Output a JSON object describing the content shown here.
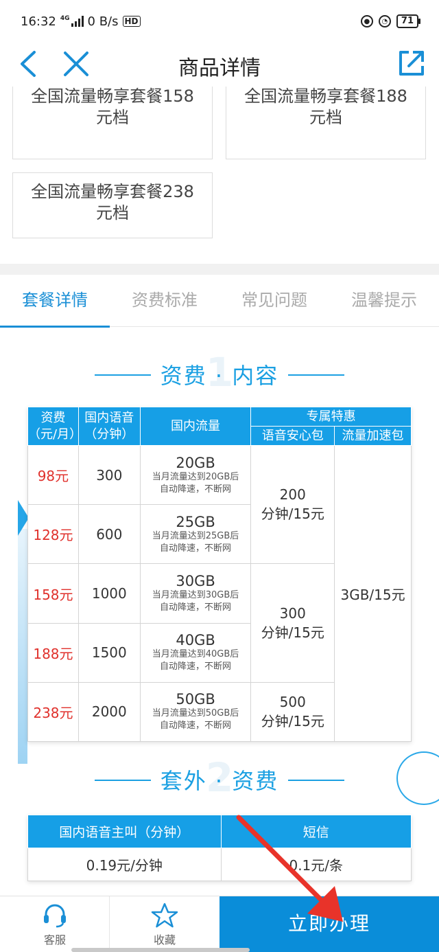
{
  "status_bar": {
    "time": "16:32",
    "network": "4G",
    "speed": "0 B/s",
    "hd_badge": "HD",
    "battery": "71"
  },
  "nav": {
    "title": "商品详情"
  },
  "packages": [
    {
      "line1": "全国流量畅享套餐158",
      "line2": "元档"
    },
    {
      "line1": "全国流量畅享套餐188",
      "line2": "元档"
    },
    {
      "line1": "全国流量畅享套餐238",
      "line2": "元档"
    }
  ],
  "tabs": [
    "套餐详情",
    "资费标准",
    "常见问题",
    "温馨提示"
  ],
  "section1": {
    "num": "1",
    "title": "资费 · 内容"
  },
  "section2": {
    "num": "2",
    "title": "套外 · 资费"
  },
  "fee_table": {
    "headers": {
      "fee": "资费",
      "fee_unit": "（元/月）",
      "voice": "国内语音",
      "voice_unit": "（分钟）",
      "data": "国内流量",
      "special": "专属特惠",
      "voice_pack": "语音安心包",
      "data_boost": "流量加速包"
    },
    "rows": [
      {
        "price": "98元",
        "voice": "300",
        "data": "20GB",
        "note1": "当月流量达到20GB后",
        "note2": "自动降速，不断网"
      },
      {
        "price": "128元",
        "voice": "600",
        "data": "25GB",
        "note1": "当月流量达到25GB后",
        "note2": "自动降速，不断网"
      },
      {
        "price": "158元",
        "voice": "1000",
        "data": "30GB",
        "note1": "当月流量达到30GB后",
        "note2": "自动降速，不断网"
      },
      {
        "price": "188元",
        "voice": "1500",
        "data": "40GB",
        "note1": "当月流量达到40GB后",
        "note2": "自动降速，不断网"
      },
      {
        "price": "238元",
        "voice": "2000",
        "data": "50GB",
        "note1": "当月流量达到50GB后",
        "note2": "自动降速，不断网"
      }
    ],
    "voice_packs": [
      {
        "amount": "200",
        "price": "分钟/15元"
      },
      {
        "amount": "300",
        "price": "分钟/15元"
      },
      {
        "amount": "500",
        "price": "分钟/15元"
      }
    ],
    "data_boost": "3GB/15元"
  },
  "extra_table": {
    "h1": "国内语音主叫（分钟）",
    "h2": "短信",
    "v1": "0.19元/分钟",
    "v2": "0.1元/条"
  },
  "bottom_bar": {
    "service": "客服",
    "favorite": "收藏",
    "apply": "立即办理"
  },
  "colors": {
    "accent": "#1ba0e2",
    "header_blue": "#169fe6",
    "apply_blue": "#0a8dd9",
    "price_red": "#e0312c",
    "annotation_red": "#e8332a"
  }
}
